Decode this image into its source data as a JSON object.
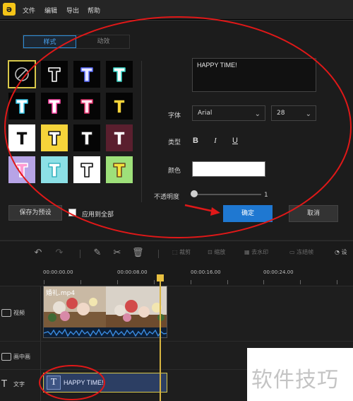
{
  "menu": [
    "文件",
    "编辑",
    "导出",
    "帮助"
  ],
  "tabs": {
    "style": "样式",
    "animation": "动效"
  },
  "text_value": "HAPPY TIME!",
  "font": {
    "label": "字体",
    "family": "Arial",
    "size": "28"
  },
  "type": {
    "label": "类型",
    "bold": "B",
    "italic": "I",
    "underline": "U"
  },
  "color": {
    "label": "颜色",
    "value": "#ffffff"
  },
  "opacity": {
    "label": "不透明度",
    "value": "1"
  },
  "buttons": {
    "save_preset": "保存为预设",
    "apply_all": "应用到全部",
    "confirm": "确定",
    "cancel": "取消"
  },
  "toolbar": {
    "crop": "裁剪",
    "zoom": "缩放",
    "remove_watermark": "去水印",
    "freeze_frame": "冻结帧",
    "settings": "设"
  },
  "ruler": [
    "00:00:00.00",
    "00:00:08.00",
    "00:00:16.00",
    "00:00:24.00"
  ],
  "tracks": {
    "video": "视频",
    "pip": "画中画",
    "text": "文字"
  },
  "video_clip": "婚礼.mp4",
  "text_clip": "HAPPY TIME!",
  "watermark": "软件技巧",
  "colors": {
    "accent": "#1f78d1",
    "highlight": "#d8c84a",
    "annotation": "#e01818"
  }
}
